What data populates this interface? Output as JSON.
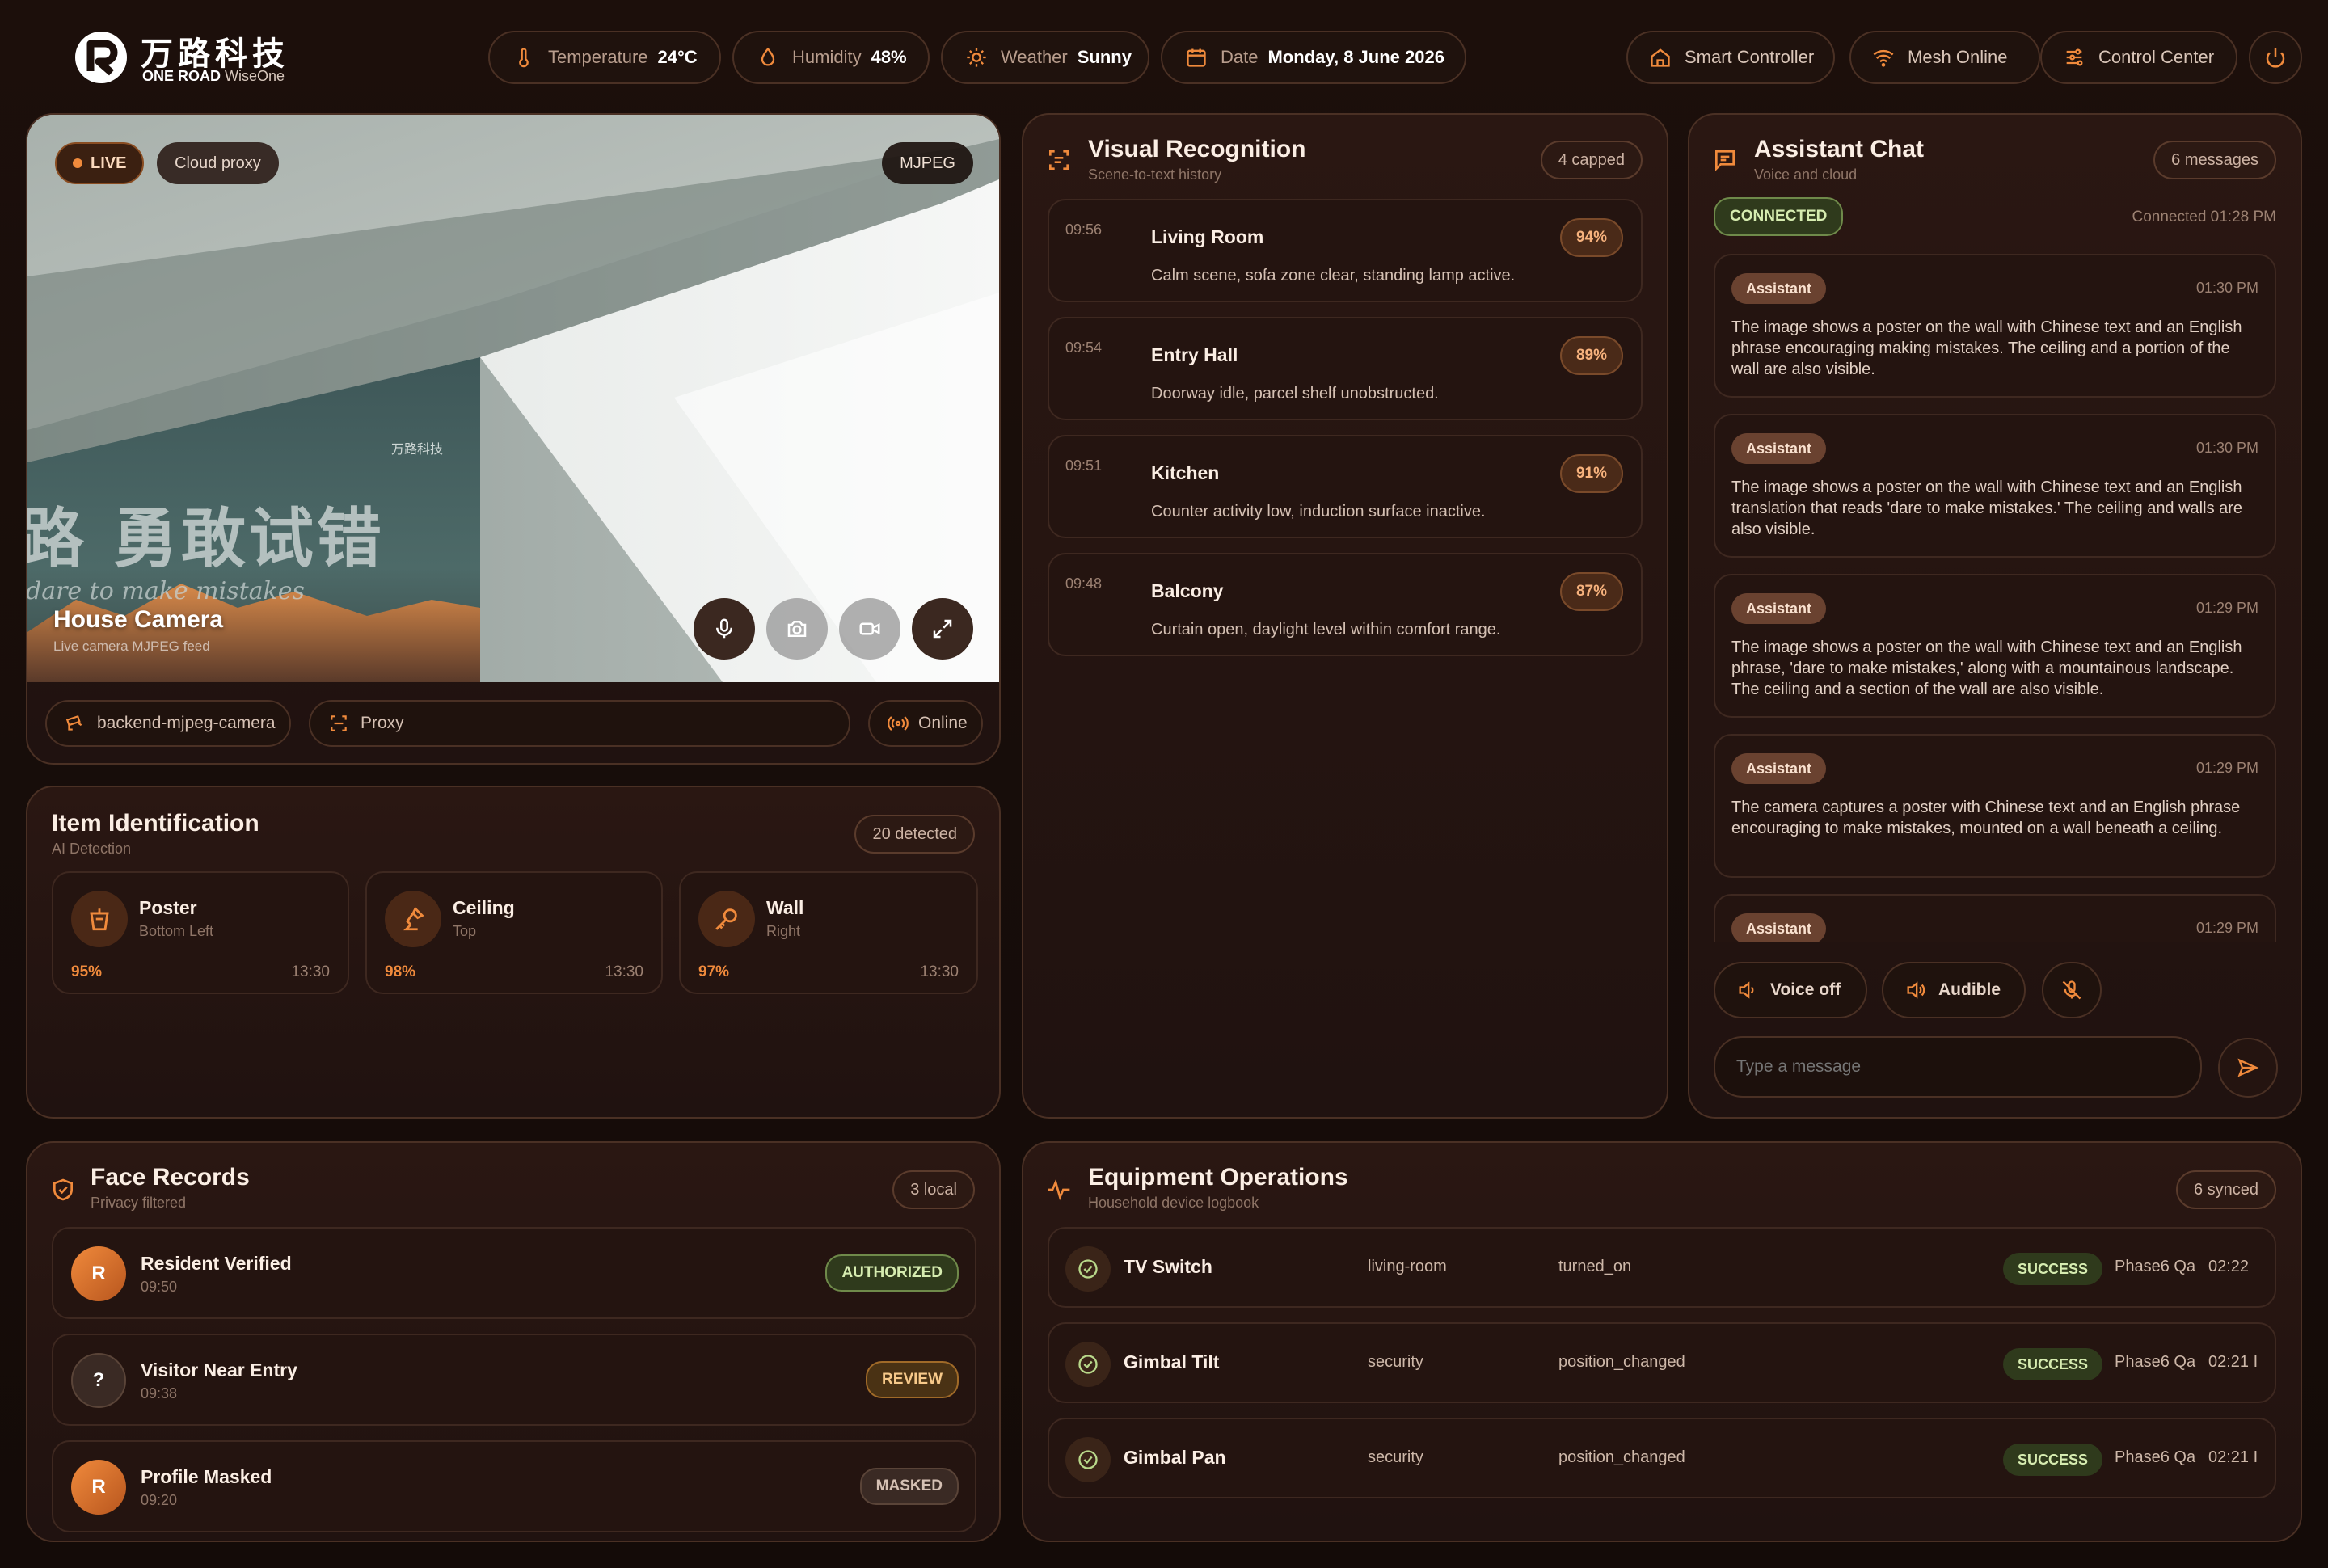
{
  "brand": {
    "name_cn": "万路科技",
    "name_en_a": "ONE ROAD",
    "name_en_b": "WiseOne"
  },
  "status": {
    "temperature": {
      "label": "Temperature",
      "value": "24°C"
    },
    "humidity": {
      "label": "Humidity",
      "value": "48%"
    },
    "weather": {
      "label": "Weather",
      "value": "Sunny"
    },
    "date": {
      "label": "Date",
      "value": "Monday, 8 June 2026"
    }
  },
  "nav": {
    "smart": "Smart Controller",
    "mesh": "Mesh Online",
    "control": "Control Center"
  },
  "camera": {
    "live": "LIVE",
    "proxy_chip": "Cloud proxy",
    "format": "MJPEG",
    "title": "House Camera",
    "subtitle": "Live camera MJPEG feed",
    "poster_cn": "路 勇敢试错",
    "poster_en": "dare to make mistakes",
    "poster_logo": "万路科技",
    "source": "backend-mjpeg-camera",
    "route": "Proxy",
    "state": "Online"
  },
  "items": {
    "title": "Item Identification",
    "subtitle": "AI Detection",
    "count": "20 detected",
    "list": [
      {
        "name": "Poster",
        "pos": "Bottom Left",
        "pct": "95%",
        "time": "13:30"
      },
      {
        "name": "Ceiling",
        "pos": "Top",
        "pct": "98%",
        "time": "13:30"
      },
      {
        "name": "Wall",
        "pos": "Right",
        "pct": "97%",
        "time": "13:30"
      }
    ]
  },
  "vision": {
    "title": "Visual Recognition",
    "subtitle": "Scene-to-text history",
    "count": "4 capped",
    "list": [
      {
        "time": "09:56",
        "room": "Living Room",
        "pct": "94%",
        "desc": "Calm scene, sofa zone clear, standing lamp active."
      },
      {
        "time": "09:54",
        "room": "Entry Hall",
        "pct": "89%",
        "desc": "Doorway idle, parcel shelf unobstructed."
      },
      {
        "time": "09:51",
        "room": "Kitchen",
        "pct": "91%",
        "desc": "Counter activity low, induction surface inactive."
      },
      {
        "time": "09:48",
        "room": "Balcony",
        "pct": "87%",
        "desc": "Curtain open, daylight level within comfort range."
      }
    ]
  },
  "chat": {
    "title": "Assistant Chat",
    "subtitle": "Voice and cloud",
    "count": "6 messages",
    "status": "CONNECTED",
    "connected_at": "Connected 01:28 PM",
    "messages": [
      {
        "role": "Assistant",
        "time": "01:30 PM",
        "text": "The image shows a poster on the wall with Chinese text and an English phrase encouraging making mistakes. The ceiling and a portion of the wall are also visible."
      },
      {
        "role": "Assistant",
        "time": "01:30 PM",
        "text": "The image shows a poster on the wall with Chinese text and an English translation that reads 'dare to make mistakes.' The ceiling and walls are also visible."
      },
      {
        "role": "Assistant",
        "time": "01:29 PM",
        "text": "The image shows a poster on the wall with Chinese text and an English phrase, 'dare to make mistakes,' along with a mountainous landscape. The ceiling and a section of the wall are also visible."
      },
      {
        "role": "Assistant",
        "time": "01:29 PM",
        "text": "The camera captures a poster with Chinese text and an English phrase encouraging to make mistakes, mounted on a wall beneath a ceiling."
      },
      {
        "role": "Assistant",
        "time": "01:29 PM",
        "text": ""
      }
    ],
    "voice_off": "Voice off",
    "audible": "Audible",
    "placeholder": "Type a message"
  },
  "faces": {
    "title": "Face Records",
    "subtitle": "Privacy filtered",
    "count": "3 local",
    "list": [
      {
        "avatar": "R",
        "name": "Resident Verified",
        "time": "09:50",
        "tag": "AUTHORIZED"
      },
      {
        "avatar": "?",
        "name": "Visitor Near Entry",
        "time": "09:38",
        "tag": "REVIEW"
      },
      {
        "avatar": "R",
        "name": "Profile Masked",
        "time": "09:20",
        "tag": "MASKED"
      }
    ]
  },
  "equipment": {
    "title": "Equipment Operations",
    "subtitle": "Household device logbook",
    "count": "6 synced",
    "list": [
      {
        "name": "TV Switch",
        "zone": "living-room",
        "action": "turned_on",
        "status": "SUCCESS",
        "user": "Phase6 Qa",
        "time": "02:22"
      },
      {
        "name": "Gimbal Tilt",
        "zone": "security",
        "action": "position_changed",
        "status": "SUCCESS",
        "user": "Phase6 Qa",
        "time": "02:21 I"
      },
      {
        "name": "Gimbal Pan",
        "zone": "security",
        "action": "position_changed",
        "status": "SUCCESS",
        "user": "Phase6 Qa",
        "time": "02:21 I"
      }
    ]
  },
  "colors": {
    "accent": "#f08a3c",
    "success": "#c9e6a0",
    "bg": "#1a0e0b"
  }
}
